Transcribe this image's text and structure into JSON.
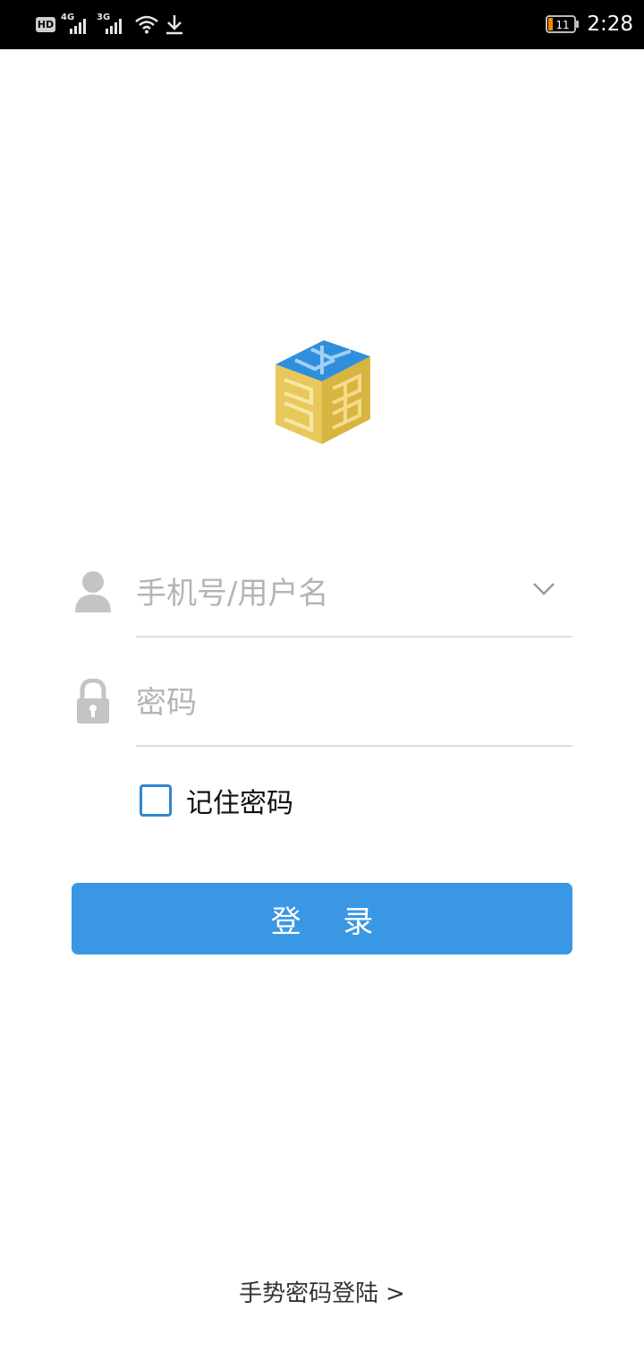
{
  "status_bar": {
    "hd_label": "HD",
    "sim1_network": "4G",
    "sim2_network": "3G",
    "battery_level": "11",
    "time": "2:28",
    "icons": [
      "hd-icon",
      "signal-icon",
      "signal-icon",
      "wifi-icon",
      "download-icon",
      "battery-icon"
    ]
  },
  "login_form": {
    "username_placeholder": "手机号/用户名",
    "password_placeholder": "密码",
    "remember_label": "记住密码",
    "remember_checked": false,
    "login_button": "登 录"
  },
  "footer": {
    "gesture_link": "手势密码登陆",
    "gesture_arrow": ">"
  },
  "colors": {
    "primary": "#3a97e3",
    "checkbox_border": "#2f87d1",
    "logo_gold": "#e8c85a",
    "logo_blue": "#2f8fdc",
    "placeholder": "#b4b4b4",
    "icon_gray": "#c4c4c4"
  }
}
